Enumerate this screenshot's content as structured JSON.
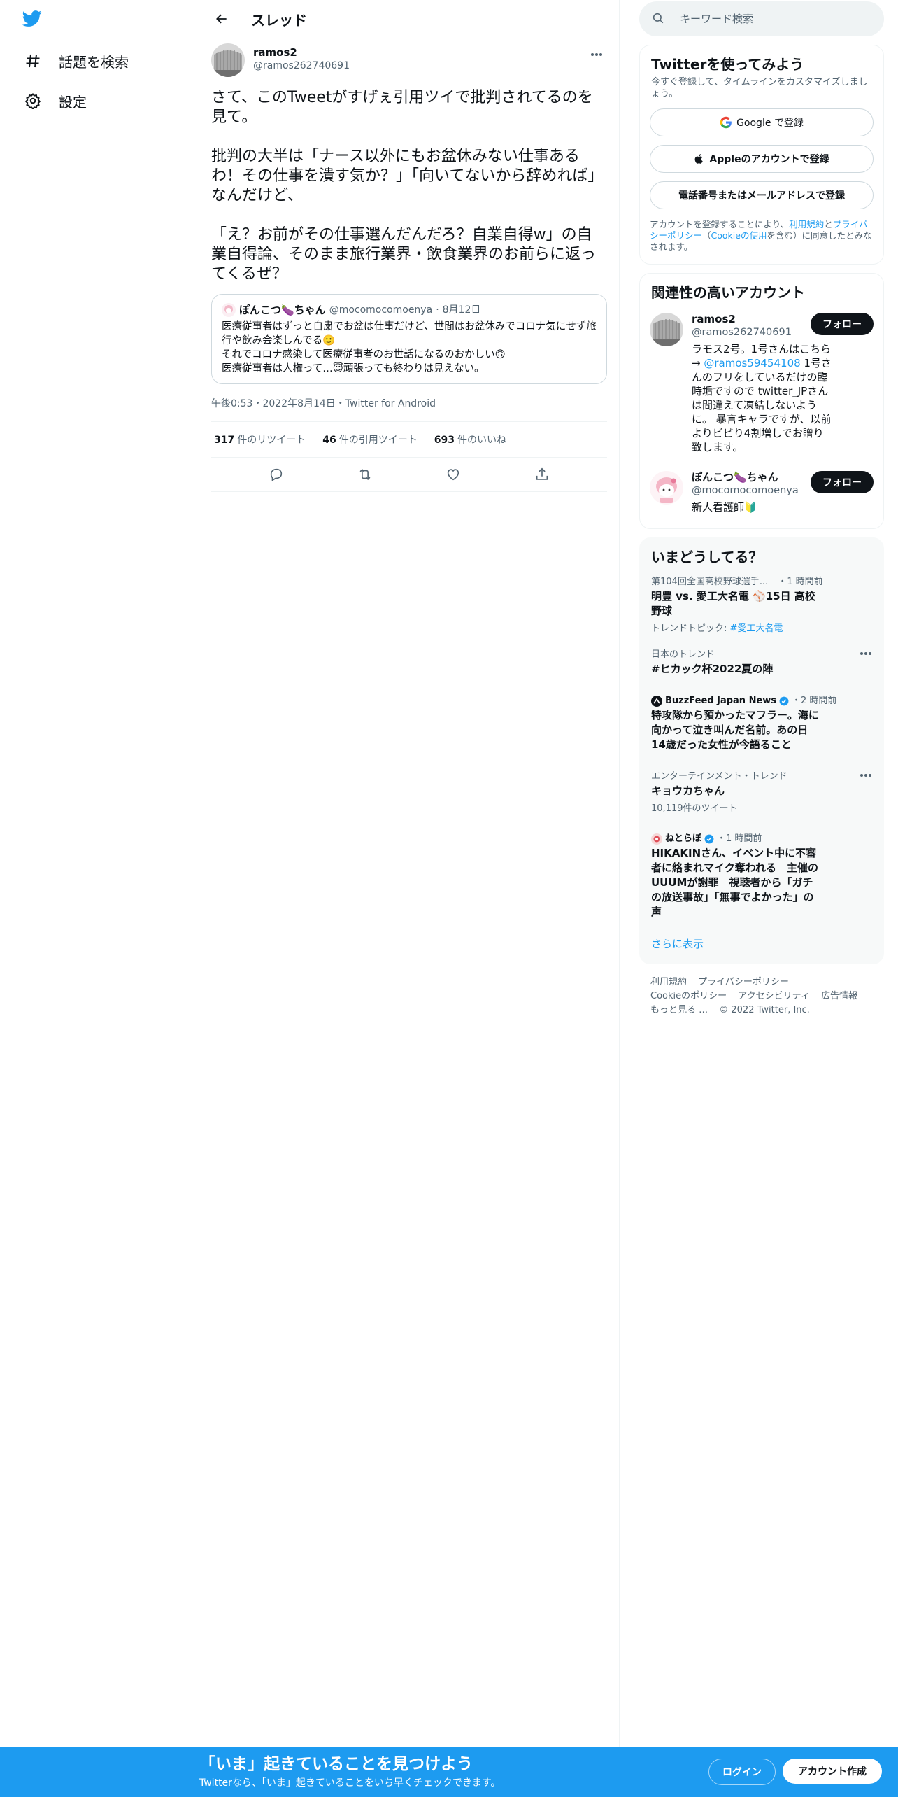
{
  "colors": {
    "brand": "#1d9bf0",
    "text": "#0f1419",
    "muted": "#536471",
    "border": "#eff3f4"
  },
  "nav": {
    "logo_icon": "twitter-bird-icon",
    "items": [
      {
        "icon": "hashtag-icon",
        "label": "話題を検索"
      },
      {
        "icon": "gear-icon",
        "label": "設定"
      }
    ]
  },
  "header": {
    "back_icon": "arrow-left-icon",
    "title": "スレッド"
  },
  "tweet": {
    "author_name": "ramos2",
    "author_handle": "@ramos262740691",
    "text": "さて、このTweetがすげぇ引用ツイで批判されてるのを見て。\n\n批判の大半は「ナース以外にもお盆休みない仕事あるわ！その仕事を潰す気か？」「向いてないから辞めれば」なんだけど、\n\n「え？お前がその仕事選んだんだろ？自業自得w」の自業自得論、そのまま旅行業界・飲食業界のお前らに返ってくるぜ？",
    "quote": {
      "name": "ぽんこつ🍆ちゃん",
      "handle": "@mocomocomoenya",
      "separator": "·",
      "date": "8月12日",
      "text": "医療従事者はずっと自粛でお盆は仕事だけど、世間はお盆休みでコロナ気にせず旅行や飲み会楽しんでる🙂\nそれでコロナ感染して医療従事者のお世話になるのおかしい🙃\n医療従事者は人権って…😇頑張っても終わりは見えない。"
    },
    "meta": "午後0:53・2022年8月14日・Twitter for Android",
    "stats": [
      {
        "count": "317",
        "label": "件のリツイート"
      },
      {
        "count": "46",
        "label": "件の引用ツイート"
      },
      {
        "count": "693",
        "label": "件のいいね"
      }
    ],
    "actions": [
      "reply-icon",
      "retweet-icon",
      "like-icon",
      "share-icon"
    ]
  },
  "search": {
    "placeholder": "キーワード検索"
  },
  "signup": {
    "title": "Twitterを使ってみよう",
    "subtitle": "今すぐ登録して、タイムラインをカスタマイズしましょう。",
    "google_label": "Google で登録",
    "apple_label": "Appleのアカウントで登録",
    "phone_label": "電話番号またはメールアドレスで登録",
    "terms_prefix": "アカウントを登録することにより、",
    "terms_link1": "利用規約",
    "terms_and": "と",
    "terms_link2": "プライバシーポリシー",
    "terms_paren_open": "（",
    "terms_link3": "Cookieの使用",
    "terms_suffix": "を含む）に同意したとみなされます。"
  },
  "related": {
    "title": "関連性の高いアカウント",
    "follow_label": "フォロー",
    "accounts": [
      {
        "name": "ramos2",
        "handle": "@ramos262740691",
        "bio_before": "ラモス2号。1号さんはこちら→ ",
        "bio_link": "@ramos59454108",
        "bio_after": " 1号さんのフリをしているだけの臨時垢ですので twitter_JPさんは間違えて凍結しないように。 暴言キャラですが、以前よりビビり4割増しでお贈り致します。"
      },
      {
        "name": "ぽんこつ🍆ちゃん",
        "handle": "@mocomocomoenya",
        "bio_before": "新人看護師🔰",
        "bio_link": "",
        "bio_after": ""
      }
    ]
  },
  "trends": {
    "title": "いまどうしてる？",
    "items": [
      {
        "context": "第104回全国高校野球選手...",
        "time": "・1 時間前",
        "title": "明豊 vs. 愛工大名電 ⚾15日 高校野球",
        "sub_label": "トレンドトピック: ",
        "sub_link": "#愛工大名電",
        "has_more": false
      },
      {
        "context": "日本のトレンド",
        "time": "",
        "title": "#ヒカック杯2022夏の陣",
        "sub_label": "",
        "sub_link": "",
        "has_more": true
      },
      {
        "source": "BuzzFeed Japan News",
        "time": "・2 時間前",
        "title": "特攻隊から預かったマフラー。海に向かって泣き叫んだ名前。あの日14歳だった女性が今語ること",
        "has_more": false
      },
      {
        "context": "エンターテインメント・トレンド",
        "time": "",
        "title": "キョウカちゃん",
        "sub_label": "10,119件のツイート",
        "sub_link": "",
        "has_more": true
      },
      {
        "source": "ねとらぼ",
        "time": "・1 時間前",
        "title": "HIKAKINさん、イベント中に不審者に絡まれマイク奪われる　主催のUUUMが謝罪　視聴者から「ガチの放送事故」「無事でよかった」の声",
        "has_more": false
      }
    ],
    "show_more": "さらに表示"
  },
  "footer": {
    "links": [
      "利用規約",
      "プライバシーポリシー",
      "Cookieのポリシー",
      "アクセシビリティ",
      "広告情報",
      "もっと見る …",
      "© 2022 Twitter, Inc."
    ]
  },
  "banner": {
    "title": "「いま」起きていることを見つけよう",
    "subtitle": "Twitterなら、「いま」起きていることをいち早くチェックできます。",
    "login_label": "ログイン",
    "signup_label": "アカウント作成"
  }
}
